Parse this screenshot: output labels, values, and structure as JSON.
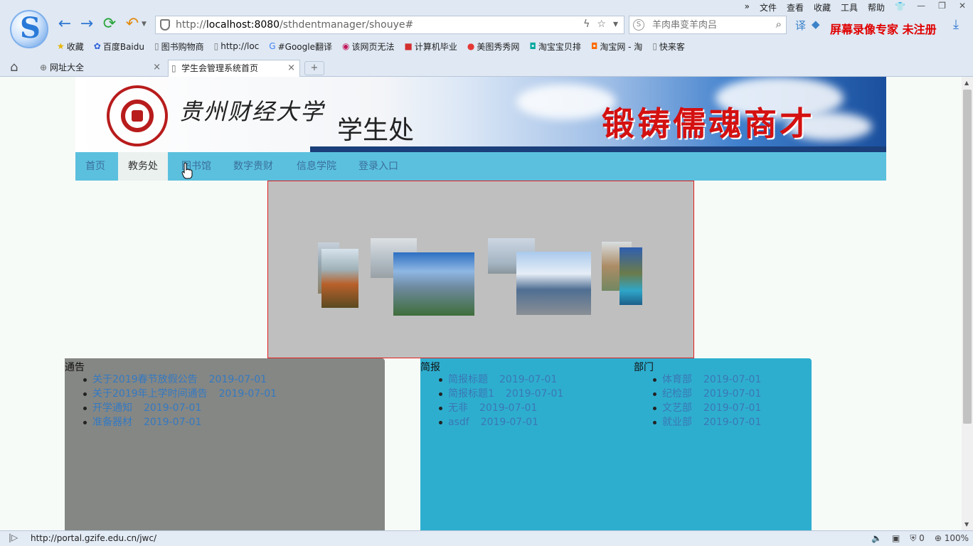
{
  "browser": {
    "menu": [
      "文件",
      "查看",
      "收藏",
      "工具",
      "帮助"
    ],
    "window_controls": [
      "minimize",
      "restore",
      "close"
    ],
    "address_url_prefix": "http://",
    "address_url_host": "localhost:8080",
    "address_url_path": "/sthdentmanager/shouye#",
    "search_placeholder": "羊肉串变羊肉吕",
    "watermark": "屏幕录像专家  未注册",
    "bookmarks": [
      {
        "icon": "star-icon",
        "label": "收藏"
      },
      {
        "icon": "baidu-icon",
        "label": "百度Baidu"
      },
      {
        "icon": "page-icon",
        "label": "图书购物商"
      },
      {
        "icon": "page-icon",
        "label": "http://loc"
      },
      {
        "icon": "google-translate-icon",
        "label": "#Google翻译"
      },
      {
        "icon": "bookmark-icon",
        "label": "该网页无法"
      },
      {
        "icon": "bookmark-icon",
        "label": "计算机毕业"
      },
      {
        "icon": "meitu-icon",
        "label": "美图秀秀网"
      },
      {
        "icon": "taobao-icon",
        "label": "淘宝宝贝排"
      },
      {
        "icon": "taobao-icon",
        "label": "淘宝网 - 淘"
      },
      {
        "icon": "page-icon",
        "label": "快来客"
      }
    ],
    "tabs": [
      {
        "label": "网址大全",
        "active": false
      },
      {
        "label": "学生会管理系统首页",
        "active": true
      }
    ],
    "status_url": "http://portal.gzife.edu.cn/jwc/",
    "status_count": "0",
    "zoom": "100%"
  },
  "page": {
    "university_name": "贵州财经大学",
    "department": "学生处",
    "slogan": "锻铸儒魂商才",
    "nav": [
      "首页",
      "教务处",
      "图书馆",
      "数字贵财",
      "信息学院",
      "登录入口"
    ],
    "active_nav": 1,
    "notice": {
      "title": "通告",
      "items": [
        {
          "title": "关于2019春节放假公告",
          "date": "2019-07-01"
        },
        {
          "title": "关于2019年上学时间通告",
          "date": "2019-07-01"
        },
        {
          "title": "开学通知",
          "date": "2019-07-01"
        },
        {
          "title": "准备器材",
          "date": "2019-07-01"
        }
      ]
    },
    "brief": {
      "title": "简报",
      "items": [
        {
          "title": "简报标题",
          "date": "2019-07-01"
        },
        {
          "title": "简报标题1",
          "date": "2019-07-01"
        },
        {
          "title": "无非",
          "date": "2019-07-01"
        },
        {
          "title": "asdf",
          "date": "2019-07-01"
        }
      ]
    },
    "departments": {
      "title": "部门",
      "items": [
        {
          "title": "体育部",
          "date": "2019-07-01"
        },
        {
          "title": "纪检部",
          "date": "2019-07-01"
        },
        {
          "title": "文艺部",
          "date": "2019-07-01"
        },
        {
          "title": "就业部",
          "date": "2019-07-01"
        }
      ]
    }
  }
}
